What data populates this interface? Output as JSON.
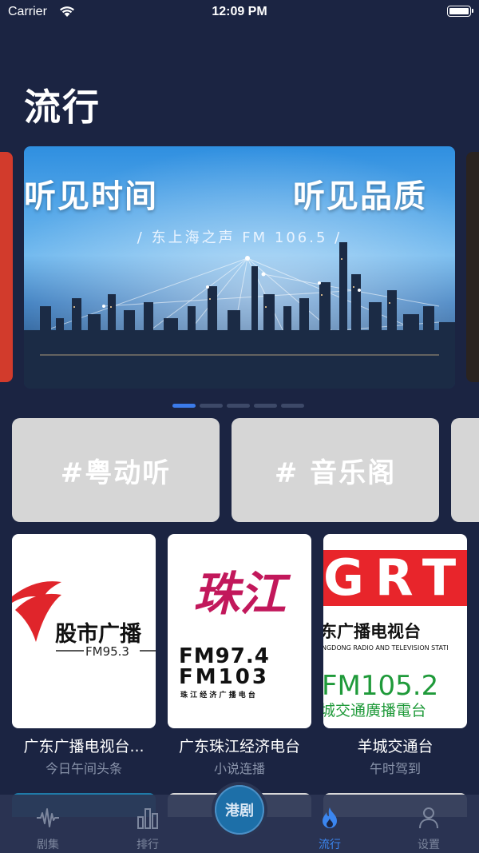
{
  "status_bar": {
    "carrier": "Carrier",
    "time": "12:09 PM"
  },
  "page": {
    "title": "流行"
  },
  "banner": {
    "headline_left": "听见时间",
    "headline_right": "听见品质",
    "subline": "/ 东上海之声 FM 106.5 /",
    "pages": 5,
    "active_page": 1
  },
  "tags": [
    {
      "label": "#粤动听"
    },
    {
      "label": "# 音乐阁"
    }
  ],
  "stations": [
    {
      "name": "广东广播电视台...",
      "subtitle": "今日午间头条",
      "logo_text": "股市广播",
      "logo_freq": "FM95.3"
    },
    {
      "name": "广东珠江经济电台",
      "subtitle": "小说连播",
      "logo_text": "珠江",
      "logo_freq1": "FM97.4",
      "logo_freq2": "FM103",
      "logo_small": "珠 江 经 济 广 播 电 台"
    },
    {
      "name": "羊城交通台",
      "subtitle": "午时驾到",
      "logo_text": "GRT",
      "logo_line1": "东广播电视台",
      "logo_line2": "NGDONG RADIO AND TELEVISION STATI",
      "logo_freq": "FM105.2",
      "logo_line3": "城交通廣播電台"
    }
  ],
  "tabbar": {
    "items": [
      {
        "label": "剧集",
        "icon": "waveform-icon"
      },
      {
        "label": "排行",
        "icon": "bar-chart-icon"
      },
      {
        "label": "港剧",
        "icon": "center-logo"
      },
      {
        "label": "流行",
        "icon": "flame-icon",
        "active": true
      },
      {
        "label": "设置",
        "icon": "person-icon"
      }
    ]
  },
  "colors": {
    "background": "#1b2442",
    "accent": "#3b86f0",
    "tag_card": "#d6d6d6",
    "tab_inactive": "#7d879e"
  }
}
